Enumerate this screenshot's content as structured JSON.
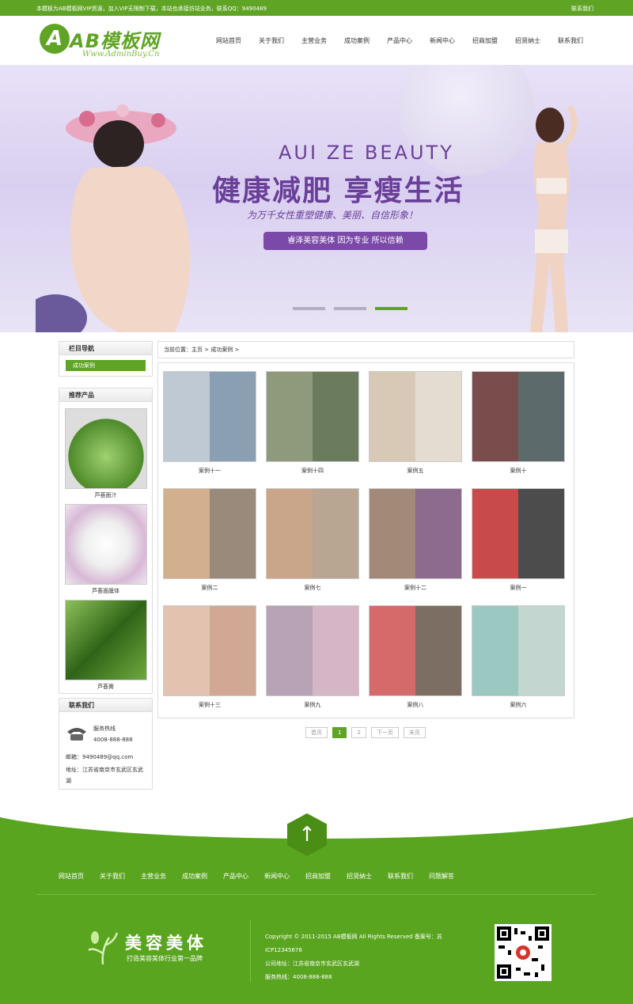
{
  "topbar": {
    "notice": "本模板为AB模板网VIP资源，加入VIP无限制下载，本站也承接仿站业务，联系QQ：9490489",
    "contact": "联系我们"
  },
  "logo": {
    "mark": "A",
    "name": "AB模板网",
    "url": "Www.AdminBuy.Cn"
  },
  "nav": [
    "网站首页",
    "关于我们",
    "主营业务",
    "成功案例",
    "产品中心",
    "新闻中心",
    "招商加盟",
    "招贤纳士",
    "联系我们"
  ],
  "banner": {
    "en": "AUI ZE BEAUTY",
    "cn": "健康减肥 享瘦生活",
    "sub": "为万千女性重塑健康、美丽、自信形象！",
    "button": "睿泽美容美体 因为专业 所以信赖",
    "slides": 3,
    "active": 3
  },
  "sidebar": {
    "nav_title": "栏目导航",
    "category": "成功案例",
    "products_title": "推荐产品",
    "products": [
      {
        "name": "芦荟面汁",
        "icon": "aloe-gel-photo"
      },
      {
        "name": "芦荟面膜体",
        "icon": "mask-powder-photo"
      },
      {
        "name": "芦荟膏",
        "icon": "aloe-leaf-photo"
      }
    ],
    "contact_title": "联系我们",
    "hotline_label": "服务热线",
    "hotline": "4008-888-888",
    "email": "邮箱：9490489@qq.com",
    "address": "地址：江苏省南京市玄武区玄武湖"
  },
  "breadcrumb": "当前位置：主页 > 成功案例 >",
  "cases": [
    "案例十一",
    "案例十四",
    "案例五",
    "案例十",
    "案例二",
    "案例七",
    "案例十二",
    "案例一",
    "案例十三",
    "案例九",
    "案例八",
    "案例六"
  ],
  "pager": [
    "首页",
    "1",
    "2",
    "下一页",
    "末页"
  ],
  "footer": {
    "top_arrow": "↑",
    "nav": [
      "网站首页",
      "关于我们",
      "主营业务",
      "成功案例",
      "产品中心",
      "新闻中心",
      "招商加盟",
      "招贤纳士",
      "联系我们",
      "问题解答"
    ],
    "brand": "美容美体",
    "slogan": "打造美容美体行业第一品牌",
    "copyright": "Copyright © 2011-2015 AB模板网 All Rights Reserved   备案号：苏ICP12345678",
    "address": "公司地址：江苏省南京市玄武区玄武湖",
    "hotline": "服务热线：4008-888-888"
  },
  "colors": {
    "brand_green": "#5fa425",
    "banner_purple": "#6a3f99",
    "button_purple": "#7b4aa9"
  }
}
